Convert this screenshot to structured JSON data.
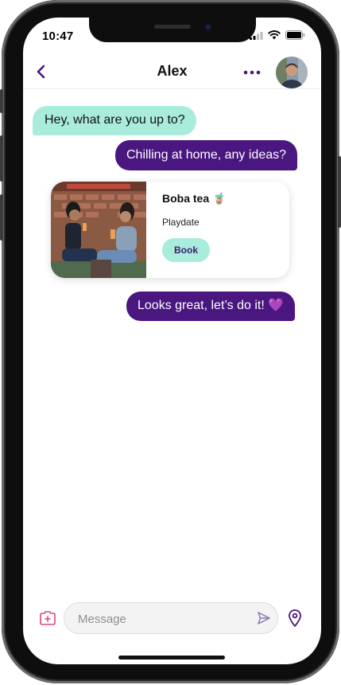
{
  "status_bar": {
    "time": "10:47"
  },
  "header": {
    "title": "Alex"
  },
  "messages": [
    {
      "direction": "incoming",
      "text": "Hey, what are you up to?"
    },
    {
      "direction": "outgoing",
      "text": "Chilling at home, any ideas?"
    },
    {
      "direction": "outgoing",
      "text": "Looks great, let’s do it! 💜"
    }
  ],
  "activity_card": {
    "title": "Boba tea 🧋",
    "subtitle": "Playdate",
    "button_label": "Book"
  },
  "composer": {
    "placeholder": "Message"
  },
  "colors": {
    "accent": "#4a1680",
    "mint": "#a9ecdc",
    "camera_icon": "#e0457b"
  }
}
